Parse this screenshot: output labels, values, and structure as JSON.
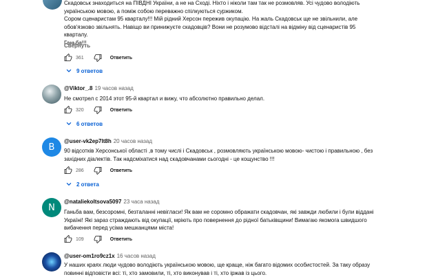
{
  "comments": [
    {
      "id": "top",
      "text_lines": [
        "Скадовськ знаходиться на ПІВДНІ України, а не на Сході. Ніхто і ніколи там так не розмовляв. Усі чудово володіють",
        "українською мовою, а поміж собою переважно спілкуються суржиком.",
        "Сором сценаристам 95 кварталу!!! Мій рідний Херсон пережив окупацію. На жаль Скадовськ ще не звільнили, але",
        "обов'язково звільнять. Навіщо ви принижуєте скадовців? Вони не розумово відсталі на відміну від сценаристів 95 кварталу.",
        "Ганьба!!!"
      ],
      "collapse_label": "Свернуть",
      "likes": "361",
      "reply_label": "Ответить",
      "replies_label": "9 ответов"
    },
    {
      "id": "viktor",
      "handle": "@Viktor_.8",
      "time": "19 часов назад",
      "text_lines": [
        "Не смотрел с 2014  этот 95-й квартал и вижу, что абсолютно правильно делал."
      ],
      "likes": "320",
      "reply_label": "Ответить",
      "replies_label": "6 ответов"
    },
    {
      "id": "vk2ep",
      "handle": "@user-vk2ep7lt8h",
      "time": "20 часов назад",
      "avatar_letter": "B",
      "text_lines": [
        "90 відсотків Херсонської області ,в тому числі і Скадовськ , розмовляють українською мовою- чистою і правильною , без",
        "західних діалектів. Так надсміхатися над скадовчанами сьогодні - це кощунство !!!"
      ],
      "likes": "286",
      "reply_label": "Ответить",
      "replies_label": "2 ответа"
    },
    {
      "id": "nataliekoltsova",
      "handle": "@nataliekoltsova5097",
      "time": "23 часа назад",
      "avatar_letter": "N",
      "text_lines": [
        "Ганьба вам, безсоромні, безталанні невігласи! Як вам не соромно ображати скадовчан, які завжди любили і були віддані",
        "Україні! Які зараз страждають від окупації, мріють про повернення до рідної батьківщини! Вимагаю якомога швидшого",
        "вибачення перед усіма мешканцями міста!"
      ],
      "likes": "109",
      "reply_label": "Ответить"
    },
    {
      "id": "om1ro",
      "handle": "@user-om1ro9cz1x",
      "time": "16 часов назад",
      "text_lines": [
        "У наших краях люди чудово володіють українською мовою, ще краще, ніж багато відомих особистостей. За таку образу",
        "повинні відповісти всі: ті, хто замовили, ті, хто виконував і ті, хто іржав із цього."
      ]
    }
  ],
  "colors": {
    "link_blue": "#065fd4",
    "secondary_text": "#606060"
  }
}
